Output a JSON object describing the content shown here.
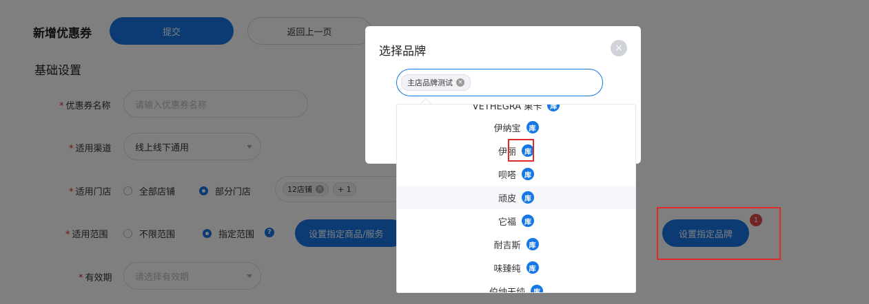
{
  "header": {
    "title": "新增优惠券",
    "submit_label": "提交",
    "back_label": "返回上一页"
  },
  "section": {
    "title": "基础设置"
  },
  "form": {
    "required_mark": "*",
    "coupon_name": {
      "label": "优惠券名称",
      "placeholder": "请输入优惠券名称"
    },
    "channel": {
      "label": "适用渠道",
      "value": "线上线下通用"
    },
    "stores": {
      "label": "适用门店",
      "option_all": "全部店铺",
      "option_partial": "部分门店",
      "tags": [
        "12店铺",
        "+ 1"
      ]
    },
    "scope": {
      "label": "适用范围",
      "option_unlimited": "不限范围",
      "option_specified": "指定范围",
      "help": "?",
      "set_goods_label": "设置指定商品/服务",
      "set_brand_label": "设置指定品牌",
      "brand_badge": "1"
    },
    "validity": {
      "label": "有效期",
      "placeholder": "请选择有效期"
    }
  },
  "modal": {
    "title": "选择品牌",
    "close": "×",
    "selected_tag": "主店品牌测试",
    "tag_remove": "×"
  },
  "dropdown": {
    "badge_text": "库",
    "options": [
      {
        "name": "VETHEGRA 果卡"
      },
      {
        "name": "伊纳宝"
      },
      {
        "name": "伊丽"
      },
      {
        "name": "呗嗒"
      },
      {
        "name": "顽皮"
      },
      {
        "name": "它福"
      },
      {
        "name": "耐吉斯"
      },
      {
        "name": "味臻纯"
      },
      {
        "name": "伯纳天纯"
      }
    ]
  }
}
